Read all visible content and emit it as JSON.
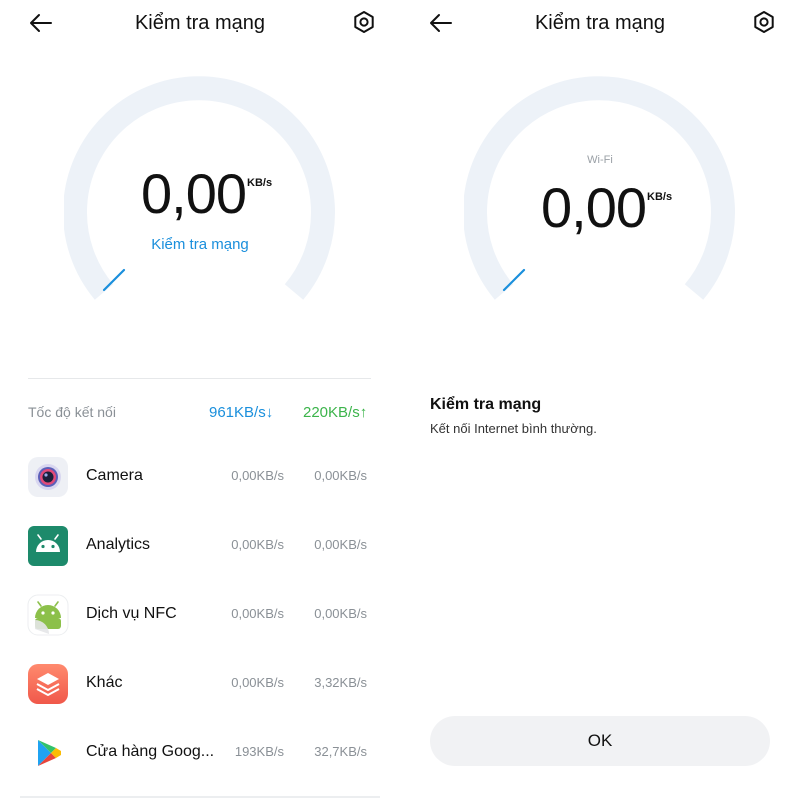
{
  "left_screen": {
    "header": {
      "title": "Kiểm tra mạng"
    },
    "gauge": {
      "value": "0,00",
      "unit": "KB/s",
      "link": "Kiểm tra mạng"
    },
    "connection": {
      "label": "Tốc độ kết nối",
      "download": "961KB/s",
      "upload": "220KB/s",
      "download_arrow": "↓",
      "upload_arrow": "↑"
    },
    "apps": [
      {
        "name": "Camera",
        "icon": "camera-icon",
        "download": "0,00KB/s",
        "upload": "0,00KB/s"
      },
      {
        "name": "Analytics",
        "icon": "android-icon",
        "download": "0,00KB/s",
        "upload": "0,00KB/s"
      },
      {
        "name": "Dịch vụ NFC",
        "icon": "nfc-service-icon",
        "download": "0,00KB/s",
        "upload": "0,00KB/s"
      },
      {
        "name": "Khác",
        "icon": "layers-icon",
        "download": "0,00KB/s",
        "upload": "3,32KB/s"
      },
      {
        "name": "Cửa hàng Goog...",
        "icon": "play-store-icon",
        "download": "193KB/s",
        "upload": "32,7KB/s"
      }
    ]
  },
  "right_screen": {
    "header": {
      "title": "Kiểm tra mạng"
    },
    "gauge": {
      "network": "Wi-Fi",
      "value": "0,00",
      "unit": "KB/s"
    },
    "result": {
      "title": "Kiểm tra mạng",
      "description": "Kết nối Internet bình thường."
    },
    "ok_label": "OK"
  },
  "colors": {
    "accent_blue": "#1a8fdc",
    "upload_green": "#3cb44b",
    "gauge_track": "#edf2f8",
    "muted_text": "#8a9096",
    "button_bg": "#f1f2f4"
  }
}
